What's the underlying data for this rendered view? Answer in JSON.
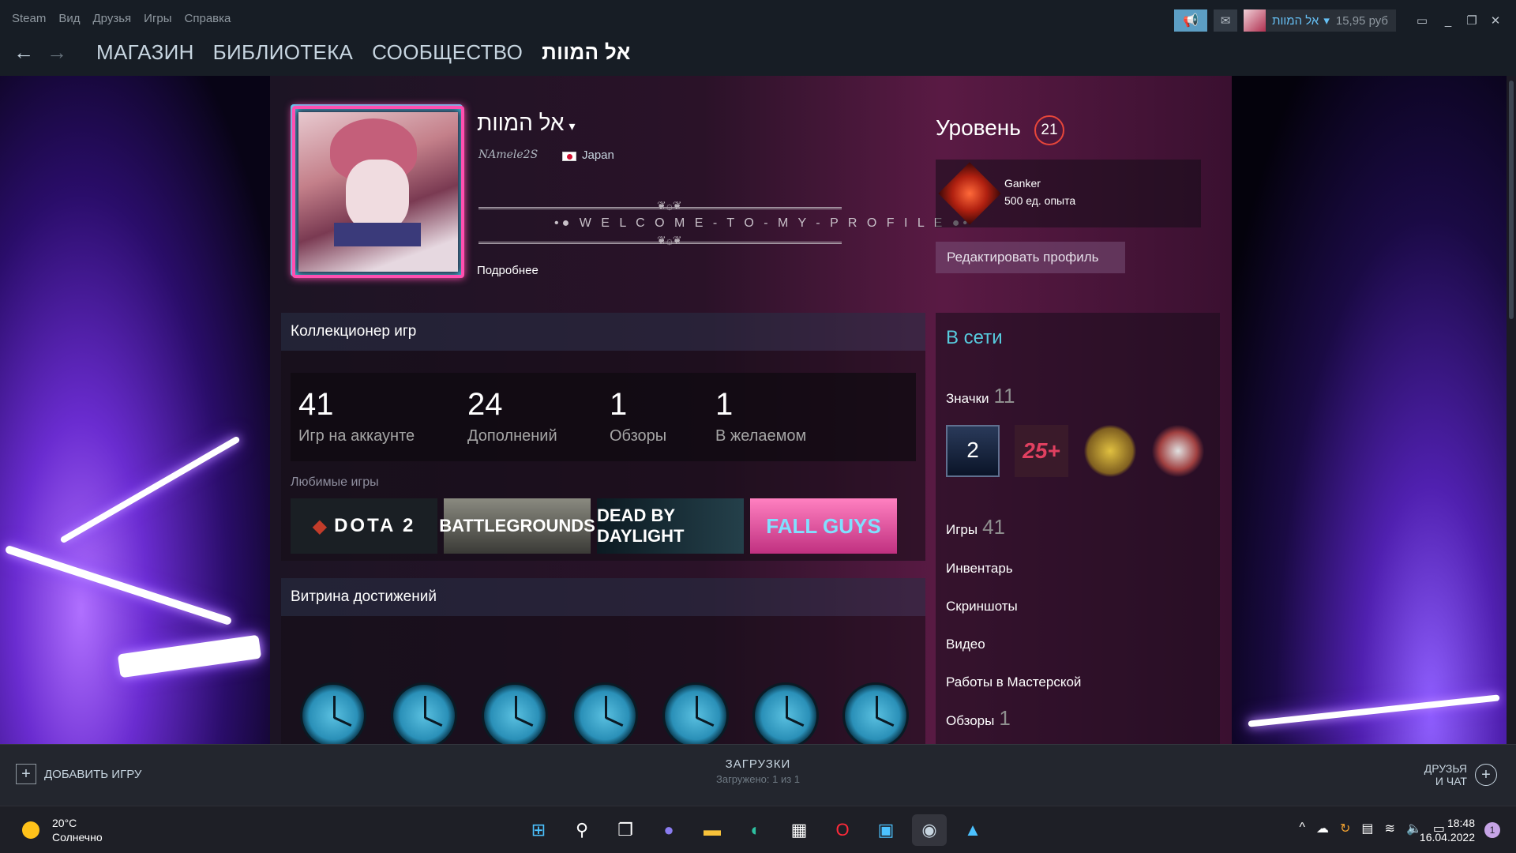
{
  "menu": [
    "Steam",
    "Вид",
    "Друзья",
    "Игры",
    "Справка"
  ],
  "nav": {
    "back_icon": "←",
    "forward_icon": "→",
    "links": [
      "МАГАЗИН",
      "БИБЛИОТЕКА",
      "СООБЩЕСТВО",
      "אל המוות"
    ]
  },
  "titlebar": {
    "account_name": "אל המוות",
    "balance": "15,95 руб",
    "announce_icon": "megaphone-icon",
    "notif_icon": "envelope-icon"
  },
  "profile": {
    "name": "אל המוות",
    "real_name": "NAmele2S",
    "country": "Japan",
    "summary": "•● W E L C O M E - T O - M Y - P R O F I L E ●•",
    "ornament": "❦۞❦",
    "more": "Подробнее",
    "level_title": "Уровень",
    "level": "21",
    "badge_name": "Ganker",
    "badge_xp": "500 ед. опыта",
    "edit_button": "Редактировать профиль"
  },
  "collector": {
    "title": "Коллекционер игр",
    "stats": [
      {
        "n": "41",
        "l": "Игр на аккаунте"
      },
      {
        "n": "24",
        "l": "Дополнений"
      },
      {
        "n": "1",
        "l": "Обзоры"
      },
      {
        "n": "1",
        "l": "В желаемом"
      }
    ],
    "fav_label": "Любимые игры",
    "games": [
      "DOTA 2",
      "BATTLEGROUNDS",
      "DEAD BY DAYLIGHT",
      "FALL GUYS"
    ]
  },
  "achievements": {
    "title": "Витрина достижений",
    "count_icons": 7
  },
  "side": {
    "online": "В сети",
    "badges_label": "Значки",
    "badges_count": "11",
    "badge1": "2",
    "badge2": "25+",
    "games_label": "Игры",
    "games_count": "41",
    "inventory": "Инвентарь",
    "screenshots": "Скриншоты",
    "videos": "Видео",
    "workshop": "Работы в Мастерской",
    "reviews_label": "Обзоры",
    "reviews_count": "1"
  },
  "bottombar": {
    "add_game": "ДОБАВИТЬ ИГРУ",
    "downloads_title": "ЗАГРУЗКИ",
    "downloads_sub": "Загружено: 1 из 1",
    "friends_line1": "ДРУЗЬЯ",
    "friends_line2": "И ЧАТ"
  },
  "taskbar": {
    "temp": "20°C",
    "weather": "Солнечно",
    "time": "18:48",
    "date": "16.04.2022",
    "notifications": "1"
  }
}
